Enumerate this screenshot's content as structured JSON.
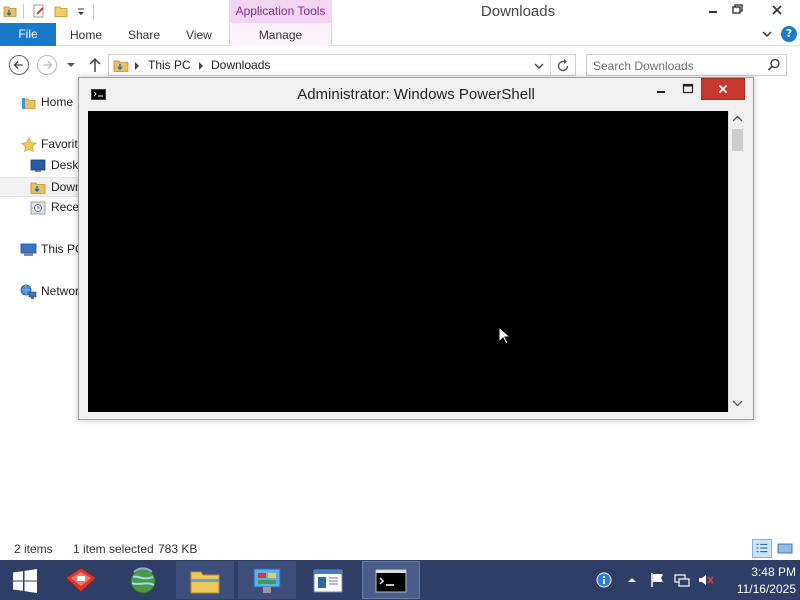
{
  "explorer": {
    "title": "Downloads",
    "contextual_tab_group": "Application Tools",
    "ribbon_tabs": {
      "file": "File",
      "home": "Home",
      "share": "Share",
      "view": "View",
      "manage": "Manage"
    },
    "address": {
      "segments": [
        "This PC",
        "Downloads"
      ]
    },
    "search": {
      "placeholder": "Search Downloads"
    },
    "nav_pane": {
      "items": [
        {
          "label": "Home",
          "icon": "home-folder-icon"
        },
        {
          "label": "Favorit",
          "icon": "star-icon"
        },
        {
          "label": "Deskt",
          "icon": "desktop-icon"
        },
        {
          "label": "Down",
          "icon": "downloads-folder-icon",
          "selected": true
        },
        {
          "label": "Recen",
          "icon": "recent-places-icon"
        },
        {
          "label": "This PC",
          "icon": "computer-icon"
        },
        {
          "label": "Networ",
          "icon": "network-icon"
        }
      ]
    },
    "status": {
      "item_count": "2 items",
      "selection": "1 item selected",
      "size": "783 KB"
    }
  },
  "powershell": {
    "title": "Administrator: Windows PowerShell"
  },
  "taskbar": {
    "clock_time": "3:48 PM",
    "clock_date": "11/16/2025",
    "buttons": [
      {
        "icon": "start-windows-icon"
      },
      {
        "icon": "server-manager-toolbox-icon"
      },
      {
        "icon": "globe-icon"
      },
      {
        "icon": "file-explorer-icon",
        "state": "running"
      },
      {
        "icon": "control-panel-icon",
        "state": "running"
      },
      {
        "icon": "notepad-window-icon"
      },
      {
        "icon": "powershell-console-icon",
        "state": "active"
      }
    ],
    "tray_icons": [
      "info-icon",
      "show-hidden-arrow-icon",
      "action-center-flag-icon",
      "network-icon",
      "volume-muted-icon"
    ]
  },
  "colors": {
    "file_tab": "#1979ca",
    "contextual_tab": "#f3d5f3",
    "taskbar": "#2e3e66",
    "close_button": "#c7392c",
    "console_bg": "#000000"
  }
}
